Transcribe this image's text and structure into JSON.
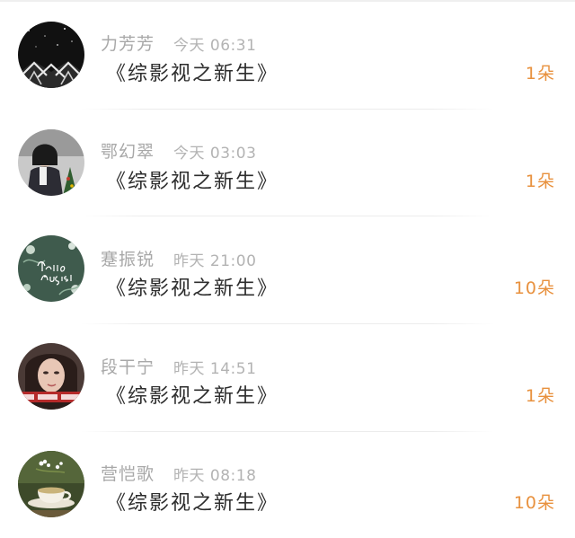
{
  "items": [
    {
      "name": "力芳芳",
      "time": "今天 06:31",
      "message": "《综影视之新生》",
      "count": "1朵",
      "avatar": "dark-geometric-avatar-image"
    },
    {
      "name": "鄂幻翠",
      "time": "今天 03:03",
      "message": "《综影视之新生》",
      "count": "1朵",
      "avatar": "girl-with-christmas-tree-avatar-image"
    },
    {
      "name": "蹇振锐",
      "time": "昨天 21:00",
      "message": "《综影视之新生》",
      "count": "10朵",
      "avatar": "hello-august-floral-avatar-image"
    },
    {
      "name": "段干宁",
      "time": "昨天 14:51",
      "message": "《综影视之新生》",
      "count": "1朵",
      "avatar": "woman-portrait-avatar-image"
    },
    {
      "name": "营恺歌",
      "time": "昨天 08:18",
      "message": "《综影视之新生》",
      "count": "10朵",
      "avatar": "teacup-with-flowers-avatar-image"
    }
  ],
  "colors": {
    "count": "#e8913e",
    "name": "#a8a8a8",
    "message": "#2d2d2d"
  }
}
